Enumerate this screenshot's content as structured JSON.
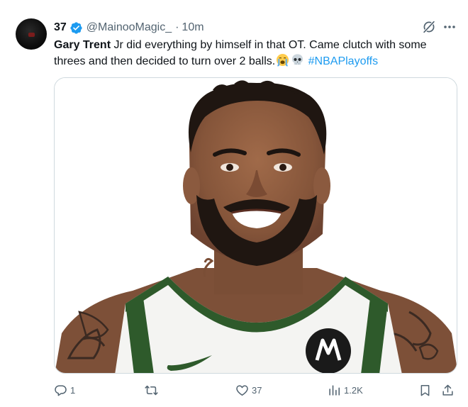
{
  "author": {
    "display_name": "37",
    "handle": "@MainooMagic_",
    "separator": "·",
    "time": "10m",
    "verified": true
  },
  "tweet": {
    "bold_name": "Gary Trent",
    "text_after_name": " Jr did everything by himself in that OT. Came clutch with some threes and then decided to turn over 2 balls.",
    "emojis": [
      "loudly-crying-face-emoji",
      "skull-emoji"
    ],
    "hashtag": "#NBAPlayoffs"
  },
  "media": {
    "image": "player-headshot-photo",
    "jersey_logo": "motorola-logo",
    "jersey_swoosh": "nike-swoosh-logo",
    "colors": {
      "jersey": "#f4f4f2",
      "trim": "#2e5a2b",
      "skin": "#8a5a3e"
    }
  },
  "actions": {
    "replies": "1",
    "reposts": "",
    "likes": "37",
    "views": "1.2K"
  },
  "colors": {
    "accent": "#1d9bf0",
    "muted": "#536471",
    "text": "#0f1419"
  }
}
